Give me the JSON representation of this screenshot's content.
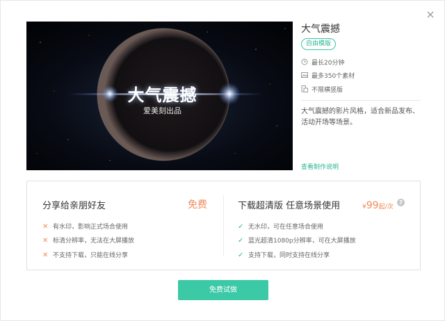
{
  "preview": {
    "title": "大气震撼",
    "subtitle": "爱美刻出品"
  },
  "info": {
    "title": "大气震撼",
    "badge": "自由模版",
    "features": [
      {
        "icon": "clock-icon",
        "text": "最长20分钟"
      },
      {
        "icon": "image-icon",
        "text": "最多350个素材"
      },
      {
        "icon": "no-portrait-icon",
        "text": "不限横竖版"
      }
    ],
    "description": "大气震撼的影片风格，适合新品发布、活动开场等场景。",
    "help_link": "查看制作说明"
  },
  "plans": {
    "free": {
      "title": "分享给亲朋好友",
      "price": "免费",
      "items": [
        "有水印，影响正式场合使用",
        "标清分辨率，无法在大屏播放",
        "不支持下载，只能在线分享"
      ]
    },
    "hd": {
      "title": "下载超清版 任意场景使用",
      "currency": "¥",
      "price": "99",
      "unit": "起/次",
      "items": [
        "无水印，可在任意场合使用",
        "蓝光超清1080p分辨率，可在大屏播放",
        "支持下载，同时支持在线分享"
      ]
    }
  },
  "cta_label": "免费试做",
  "colors": {
    "accent": "#3cc9a6",
    "price": "#f08a5a",
    "cross": "#f08a5a",
    "check": "#2cb592"
  }
}
